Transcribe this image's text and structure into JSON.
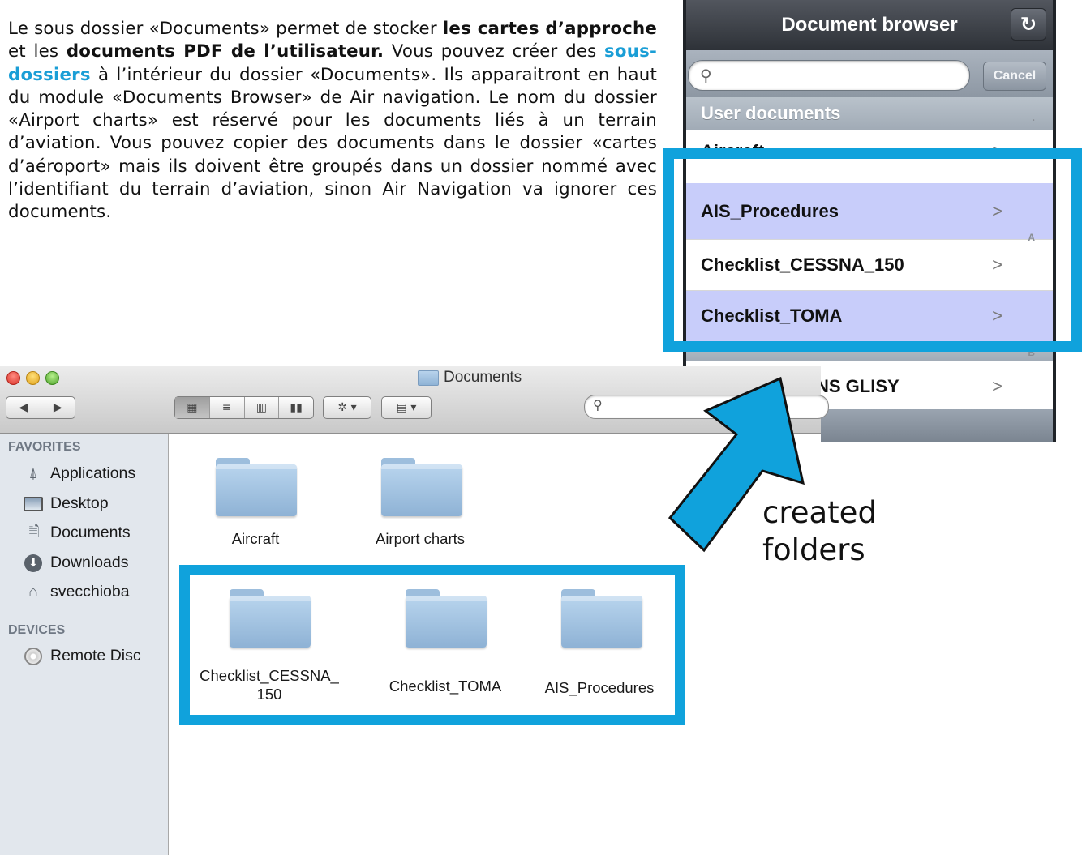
{
  "paragraph": {
    "t1": "Le sous dossier «Documents» permet de stocker ",
    "b1": "les cartes d’approche",
    "t2": " et les ",
    "b2": "documents PDF de l’utilisateur.",
    "t3": " Vous pouvez créer des ",
    "link": "sous-dossiers",
    "t4": " à l’intérieur du dossier «Documents». Ils apparaitront en haut du module «Documents Browser» de Air navigation. Le nom du dossier «Airport charts» est réservé pour les documents liés à un terrain d’aviation. Vous pouvez copier des documents dans le dossier «cartes d’aéroport» mais ils doivent être groupés dans un dossier nommé avec l’identifiant du terrain d’aviation, sinon Air Navigation va ignorer ces documents."
  },
  "ipad": {
    "title": "Document browser",
    "cancel": "Cancel",
    "section_user": "User documents",
    "rows": [
      {
        "label": "Aircraft",
        "highlighted": false
      },
      {
        "label": "AIS_Procedures",
        "highlighted": true
      },
      {
        "label": "Checklist_CESSNA_150",
        "highlighted": false
      },
      {
        "label": "Checklist_TOMA",
        "highlighted": true
      }
    ],
    "last_row": "NS GLISY",
    "index_letters": [
      ".",
      "A",
      "B"
    ]
  },
  "finder": {
    "title": "Documents",
    "sidebar": {
      "favorites_heading": "FAVORITES",
      "favorites": [
        "Applications",
        "Desktop",
        "Documents",
        "Downloads",
        "svecchioba"
      ],
      "devices_heading": "DEVICES",
      "devices": [
        "Remote Disc"
      ]
    },
    "folders": [
      {
        "name": "Aircraft"
      },
      {
        "name": "Airport charts"
      },
      {
        "name": "Checklist_CESSNA_\n150"
      },
      {
        "name": "Checklist_TOMA"
      },
      {
        "name": "AIS_Procedures"
      }
    ]
  },
  "callout": "created\nfolders",
  "colors": {
    "highlight": "#10a2dc",
    "link": "#1a9ed6",
    "row_highlight": "#c8cdfa"
  }
}
